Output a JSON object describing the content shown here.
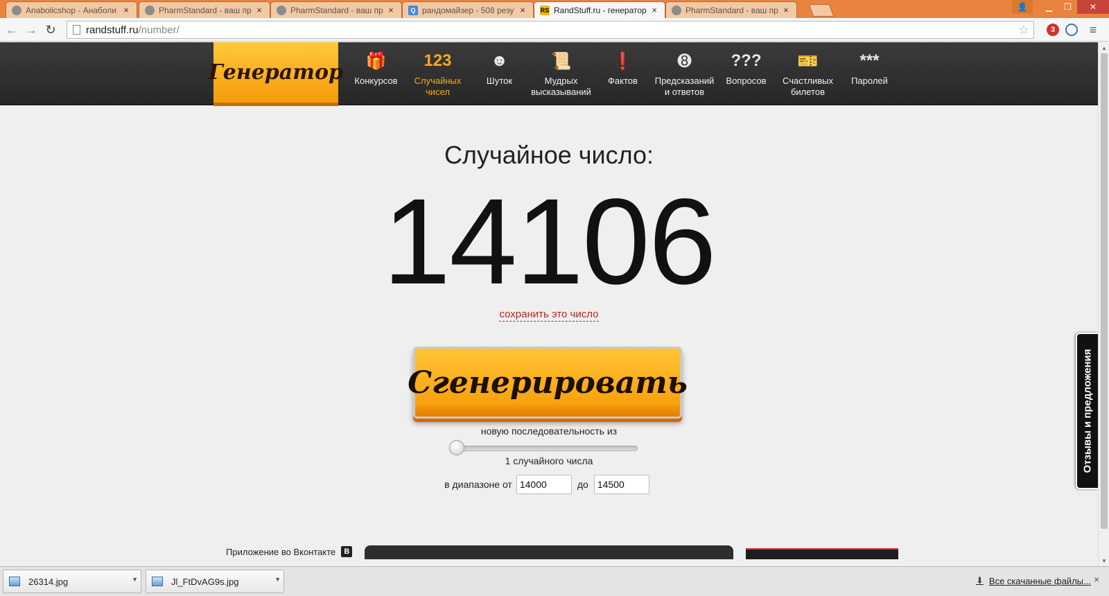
{
  "browser": {
    "tabs": [
      {
        "title": "Anabolicshop - Анаболи",
        "favicon": "doc-icon"
      },
      {
        "title": "PharmStandard - ваш пр",
        "favicon": "doc-icon"
      },
      {
        "title": "PharmStandard - ваш пр",
        "favicon": "doc-icon"
      },
      {
        "title": "рандомайзер - 508 резу",
        "favicon": "search-icon"
      },
      {
        "title": "RandStuff.ru - генератор",
        "favicon": "randstuff-icon",
        "active": true
      },
      {
        "title": "PharmStandard - ваш пр",
        "favicon": "doc-icon"
      }
    ],
    "url_host": "randstuff.ru",
    "url_path": "/number/",
    "ext_badge": "3",
    "favicon_text": "RS"
  },
  "site": {
    "logo": "Генератор",
    "nav": [
      {
        "label": "Конкурсов",
        "icon": "gift-icon",
        "glyph": "🎁"
      },
      {
        "label": "Случайных\nчисел",
        "icon": "numbers-icon",
        "glyph": "123",
        "active": true
      },
      {
        "label": "Шуток",
        "icon": "smile-icon",
        "glyph": "☻"
      },
      {
        "label": "Мудрых\nвысказываний",
        "icon": "scroll-icon",
        "glyph": "📜"
      },
      {
        "label": "Фактов",
        "icon": "warning-icon",
        "glyph": "❗"
      },
      {
        "label": "Предсказаний\nи ответов",
        "icon": "eight-ball-icon",
        "glyph": "➑"
      },
      {
        "label": "Вопросов",
        "icon": "question-icon",
        "glyph": "???"
      },
      {
        "label": "Счастливых\nбилетов",
        "icon": "ticket-icon",
        "glyph": "🎫"
      },
      {
        "label": "Паролей",
        "icon": "asterisks-icon",
        "glyph": "***"
      }
    ]
  },
  "main": {
    "heading": "Случайное число:",
    "number": "14106",
    "save_link": "сохранить это число",
    "generate_button": "Сгенерировать",
    "sequence_label": "новую последовательность из",
    "count_label": "1 случайного числа",
    "slider_value": 1,
    "range_from_label": "в диапазоне от",
    "range_from": "14000",
    "range_to_label": "до",
    "range_to": "14500",
    "vk_label": "Приложение во Вконтакте",
    "vk_icon": "В",
    "feedback": "Отзывы и предложения"
  },
  "downloads": {
    "items": [
      "26314.jpg",
      "Jl_FtDvAG9s.jpg"
    ],
    "all_link": "Все скачанные файлы..."
  },
  "colors": {
    "accent": "#f7a20e",
    "link": "#b3261e",
    "tabstrip": "#e9833e"
  }
}
